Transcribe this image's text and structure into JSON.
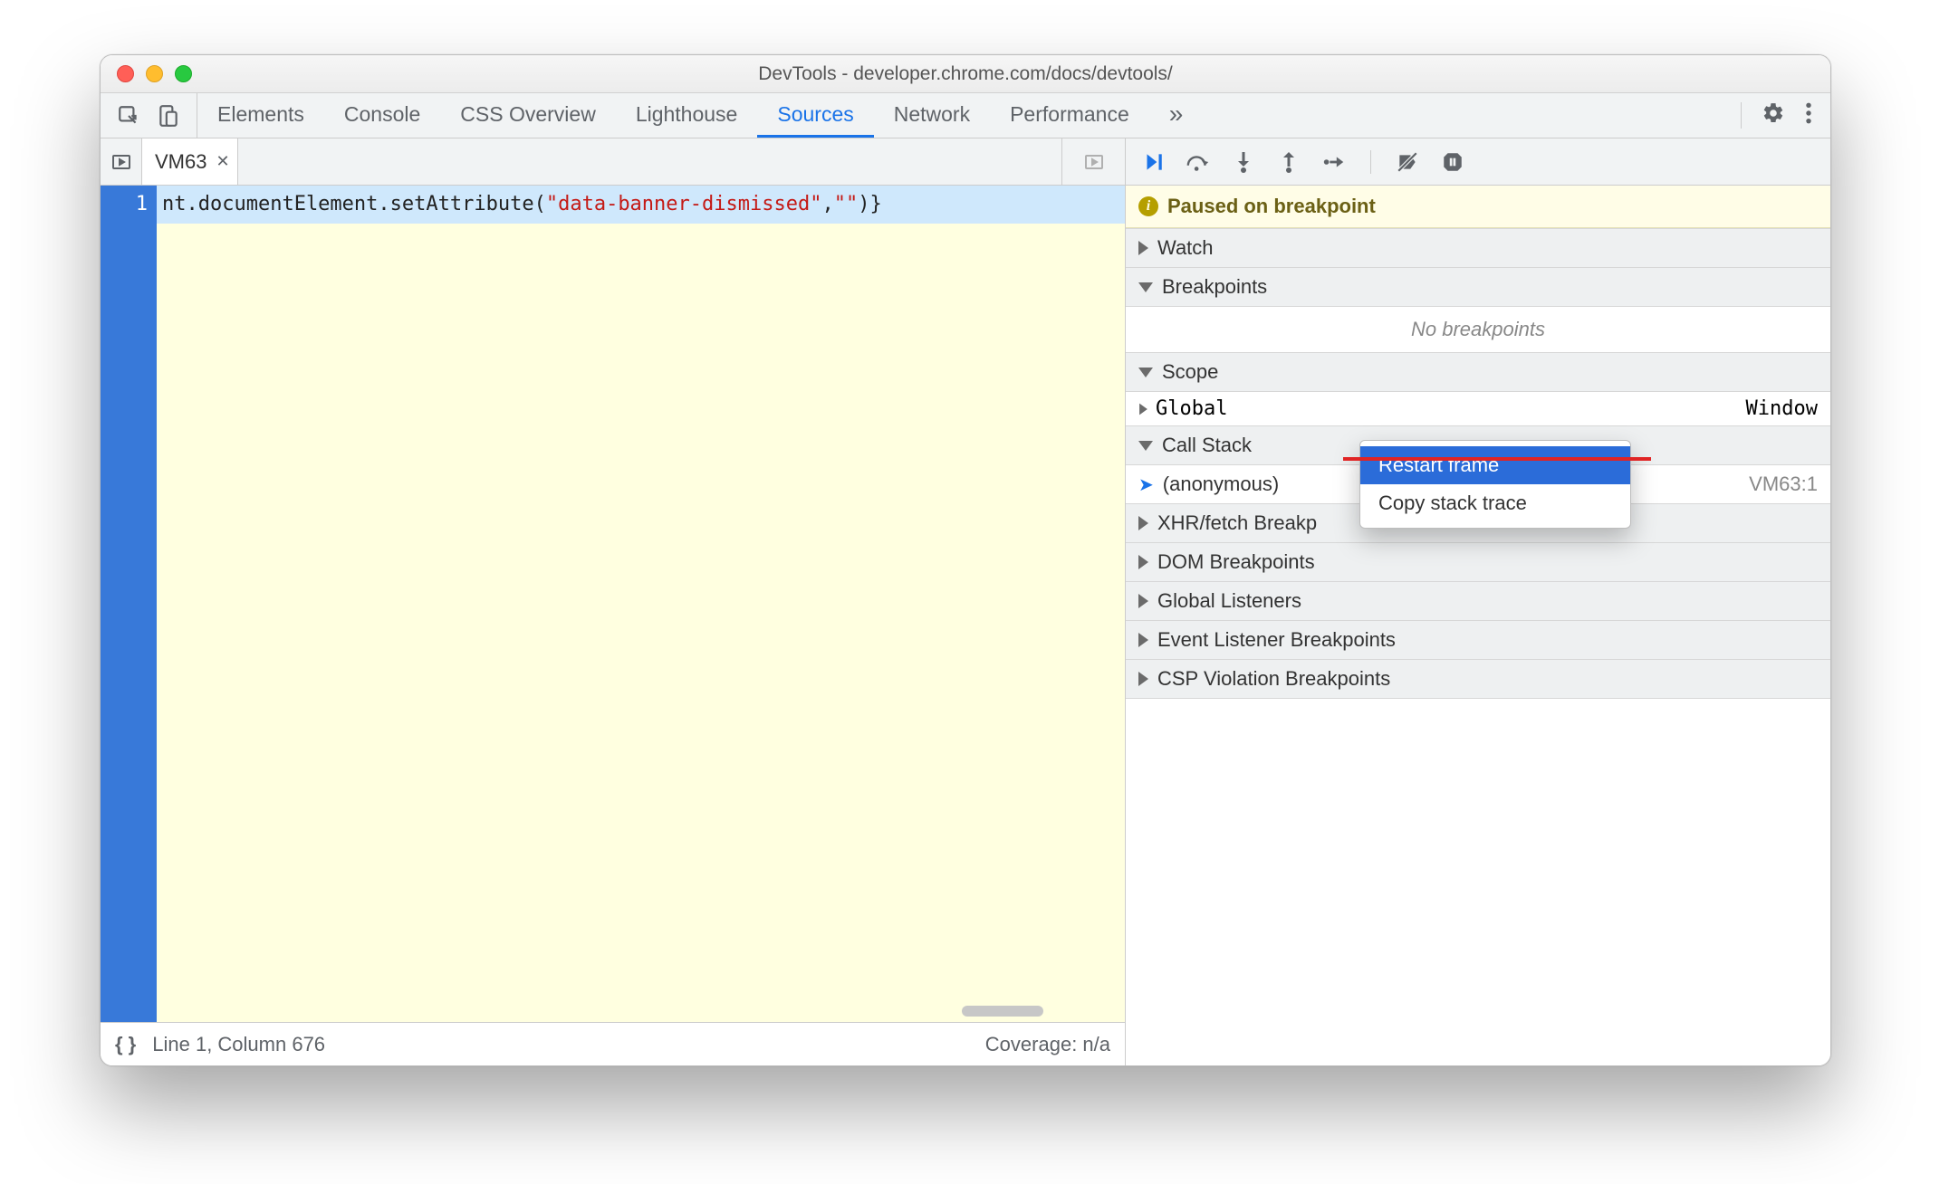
{
  "titlebar": {
    "title": "DevTools - developer.chrome.com/docs/devtools/"
  },
  "tabs": {
    "items": [
      "Elements",
      "Console",
      "CSS Overview",
      "Lighthouse",
      "Sources",
      "Network",
      "Performance"
    ],
    "active_index": 4
  },
  "file_tab": {
    "name": "VM63"
  },
  "editor": {
    "line_number": "1",
    "code_prefix": "nt.documentElement.setAttribute(",
    "code_string": "\"data-banner-dismissed\"",
    "code_mid": ",",
    "code_string2": "\"\"",
    "code_suffix": ")}"
  },
  "status_bar": {
    "pretty": "{ }",
    "position": "Line 1, Column 676",
    "coverage": "Coverage: n/a"
  },
  "paused_banner": {
    "text": "Paused on breakpoint"
  },
  "sections": {
    "watch": "Watch",
    "breakpoints": "Breakpoints",
    "no_breakpoints": "No breakpoints",
    "scope": "Scope",
    "scope_global": "Global",
    "scope_global_value": "Window",
    "call_stack": "Call Stack",
    "call_stack_item": "(anonymous)",
    "call_stack_loc": "VM63:1",
    "xhr": "XHR/fetch Breakp",
    "dom": "DOM Breakpoints",
    "global_listeners": "Global Listeners",
    "event_listener": "Event Listener Breakpoints",
    "csp": "CSP Violation Breakpoints"
  },
  "context_menu": {
    "restart_frame": "Restart frame",
    "copy_stack_trace": "Copy stack trace"
  }
}
